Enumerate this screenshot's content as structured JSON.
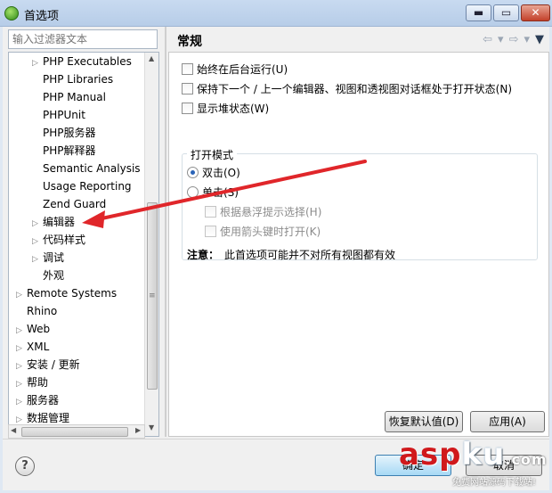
{
  "window": {
    "title": "首选项",
    "minimize": "▬",
    "maximize": "▭",
    "close": "✕"
  },
  "sidebar": {
    "filter_placeholder": "输入过滤器文本",
    "items": [
      {
        "label": "PHP Executables",
        "expander": "▷",
        "depth": 1
      },
      {
        "label": "PHP Libraries",
        "expander": "",
        "depth": 1
      },
      {
        "label": "PHP Manual",
        "expander": "",
        "depth": 1
      },
      {
        "label": "PHPUnit",
        "expander": "",
        "depth": 1
      },
      {
        "label": "PHP服务器",
        "expander": "",
        "depth": 1
      },
      {
        "label": "PHP解释器",
        "expander": "",
        "depth": 1
      },
      {
        "label": "Semantic Analysis",
        "expander": "",
        "depth": 1
      },
      {
        "label": "Usage Reporting",
        "expander": "",
        "depth": 1
      },
      {
        "label": "Zend Guard",
        "expander": "",
        "depth": 1
      },
      {
        "label": "编辑器",
        "expander": "▷",
        "depth": 1
      },
      {
        "label": "代码样式",
        "expander": "▷",
        "depth": 1
      },
      {
        "label": "调试",
        "expander": "▷",
        "depth": 1
      },
      {
        "label": "外观",
        "expander": "",
        "depth": 1
      },
      {
        "label": "Remote Systems",
        "expander": "▷",
        "depth": 0
      },
      {
        "label": "Rhino",
        "expander": "",
        "depth": 0
      },
      {
        "label": "Web",
        "expander": "▷",
        "depth": 0
      },
      {
        "label": "XML",
        "expander": "▷",
        "depth": 0
      },
      {
        "label": "安装 / 更新",
        "expander": "▷",
        "depth": 0
      },
      {
        "label": "帮助",
        "expander": "▷",
        "depth": 0
      },
      {
        "label": "服务器",
        "expander": "▷",
        "depth": 0
      },
      {
        "label": "数据管理",
        "expander": "▷",
        "depth": 0
      }
    ]
  },
  "page": {
    "title": "常规",
    "nav": {
      "back": "⇦",
      "back_menu": "▾",
      "forward": "⇨",
      "forward_menu": "▾",
      "view_menu": "▼"
    },
    "options": [
      {
        "label": "始终在后台运行(U)",
        "checked": false
      },
      {
        "label": "保持下一个 / 上一个编辑器、视图和透视图对话框处于打开状态(N)",
        "checked": false
      },
      {
        "label": "显示堆状态(W)",
        "checked": false
      }
    ],
    "open_mode": {
      "legend": "打开模式",
      "double_click": "双击(O)",
      "single_click": "单击(S)",
      "select_on_hover": "根据悬浮提示选择(H)",
      "open_with_arrow": "使用箭头键时打开(K)",
      "selected": "double_click"
    },
    "note_label": "注意：",
    "note_text": "此首选项可能并不对所有视图都有效",
    "restore_defaults": "恢复默认值(D)",
    "apply": "应用(A)"
  },
  "footer": {
    "help": "?",
    "ok": "确定",
    "cancel": "取消"
  },
  "watermark": {
    "text_main": "asp",
    "text_k": "ku",
    "text_com": ".com",
    "subtitle": "免费网站源码下载站!"
  },
  "colors": {
    "annotation_arrow": "#e0262a",
    "radio_dot": "#2a64b8"
  }
}
